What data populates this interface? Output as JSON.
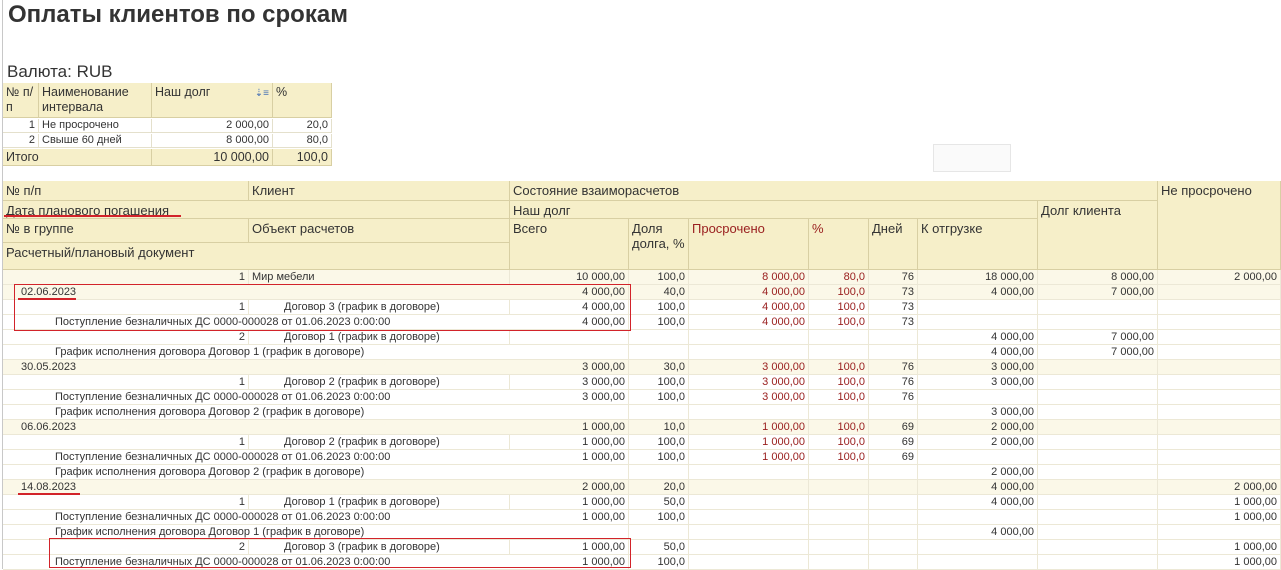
{
  "title": "Оплаты клиентов по срокам",
  "currency": "Валюта: RUB",
  "summary": {
    "headers": [
      "№ п/п",
      "Наименование интервала",
      "Наш долг",
      "%"
    ],
    "rows": [
      [
        "1",
        "Не просрочено",
        "2 000,00",
        "20,0"
      ],
      [
        "2",
        "Свыше 60 дней",
        "8 000,00",
        "80,0"
      ]
    ],
    "total": [
      "Итого",
      "10 000,00",
      "100,0"
    ]
  },
  "main": {
    "headers": {
      "npp": "№ п/п",
      "client": "Клиент",
      "state": "Состояние взаиморасчетов",
      "not_overdue": "Не просрочено",
      "date": "Дата планового погашения",
      "our_debt": "Наш долг",
      "client_debt": "Долг клиента",
      "in_group": "№ в группе",
      "object": "Объект расчетов",
      "total": "Всего",
      "share": "Доля долга, %",
      "overdue": "Просрочено",
      "percent": "%",
      "days": "Дней",
      "to_ship": "К отгрузке",
      "document": "Расчетный/плановый документ"
    },
    "rows": [
      {
        "type": "client",
        "a": "1",
        "b": "Мир мебели",
        "total": "10 000,00",
        "share": "100,0",
        "overdue": "8 000,00",
        "pct": "80,0",
        "days": "76",
        "ship": "18 000,00",
        "cdebt": "8 000,00",
        "notover": "2 000,00"
      },
      {
        "type": "date",
        "a": "02.06.2023",
        "total": "4 000,00",
        "share": "40,0",
        "overdue": "4 000,00",
        "pct": "100,0",
        "days": "73",
        "ship": "4 000,00",
        "cdebt": "7 000,00",
        "notover": ""
      },
      {
        "type": "obj",
        "a": "1",
        "b": "Договор 3 (график в договоре)",
        "total": "4 000,00",
        "share": "100,0",
        "overdue": "4 000,00",
        "pct": "100,0",
        "days": "73",
        "ship": "",
        "cdebt": "",
        "notover": ""
      },
      {
        "type": "doc",
        "a": "Поступление безналичных ДС 0000-000028 от 01.06.2023 0:00:00",
        "total": "4 000,00",
        "share": "100,0",
        "overdue": "4 000,00",
        "pct": "100,0",
        "days": "73",
        "ship": "",
        "cdebt": "",
        "notover": ""
      },
      {
        "type": "obj",
        "a": "2",
        "b": "Договор 1 (график в договоре)",
        "total": "",
        "share": "",
        "overdue": "",
        "pct": "",
        "days": "",
        "ship": "4 000,00",
        "cdebt": "7 000,00",
        "notover": ""
      },
      {
        "type": "doc",
        "a": "График исполнения договора Договор 1 (график в договоре)",
        "total": "",
        "share": "",
        "overdue": "",
        "pct": "",
        "days": "",
        "ship": "4 000,00",
        "cdebt": "7 000,00",
        "notover": ""
      },
      {
        "type": "date",
        "a": "30.05.2023",
        "total": "3 000,00",
        "share": "30,0",
        "overdue": "3 000,00",
        "pct": "100,0",
        "days": "76",
        "ship": "3 000,00",
        "cdebt": "",
        "notover": ""
      },
      {
        "type": "obj",
        "a": "1",
        "b": "Договор 2 (график в договоре)",
        "total": "3 000,00",
        "share": "100,0",
        "overdue": "3 000,00",
        "pct": "100,0",
        "days": "76",
        "ship": "3 000,00",
        "cdebt": "",
        "notover": ""
      },
      {
        "type": "doc",
        "a": "Поступление безналичных ДС 0000-000028 от 01.06.2023 0:00:00",
        "total": "3 000,00",
        "share": "100,0",
        "overdue": "3 000,00",
        "pct": "100,0",
        "days": "76",
        "ship": "",
        "cdebt": "",
        "notover": ""
      },
      {
        "type": "doc",
        "a": "График исполнения договора Договор 2 (график в договоре)",
        "total": "",
        "share": "",
        "overdue": "",
        "pct": "",
        "days": "",
        "ship": "3 000,00",
        "cdebt": "",
        "notover": ""
      },
      {
        "type": "date",
        "a": "06.06.2023",
        "total": "1 000,00",
        "share": "10,0",
        "overdue": "1 000,00",
        "pct": "100,0",
        "days": "69",
        "ship": "2 000,00",
        "cdebt": "",
        "notover": ""
      },
      {
        "type": "obj",
        "a": "1",
        "b": "Договор 2 (график в договоре)",
        "total": "1 000,00",
        "share": "100,0",
        "overdue": "1 000,00",
        "pct": "100,0",
        "days": "69",
        "ship": "2 000,00",
        "cdebt": "",
        "notover": ""
      },
      {
        "type": "doc",
        "a": "Поступление безналичных ДС 0000-000028 от 01.06.2023 0:00:00",
        "total": "1 000,00",
        "share": "100,0",
        "overdue": "1 000,00",
        "pct": "100,0",
        "days": "69",
        "ship": "",
        "cdebt": "",
        "notover": ""
      },
      {
        "type": "doc",
        "a": "График исполнения договора Договор 2 (график в договоре)",
        "total": "",
        "share": "",
        "overdue": "",
        "pct": "",
        "days": "",
        "ship": "2 000,00",
        "cdebt": "",
        "notover": ""
      },
      {
        "type": "date",
        "a": "14.08.2023",
        "total": "2 000,00",
        "share": "20,0",
        "overdue": "",
        "pct": "",
        "days": "",
        "ship": "4 000,00",
        "cdebt": "",
        "notover": "2 000,00"
      },
      {
        "type": "obj",
        "a": "1",
        "b": "Договор 1 (график в договоре)",
        "total": "1 000,00",
        "share": "50,0",
        "overdue": "",
        "pct": "",
        "days": "",
        "ship": "4 000,00",
        "cdebt": "",
        "notover": "1 000,00"
      },
      {
        "type": "doc",
        "a": "Поступление безналичных ДС 0000-000028 от 01.06.2023 0:00:00",
        "total": "1 000,00",
        "share": "100,0",
        "overdue": "",
        "pct": "",
        "days": "",
        "ship": "",
        "cdebt": "",
        "notover": "1 000,00"
      },
      {
        "type": "doc",
        "a": "График исполнения договора Договор 1 (график в договоре)",
        "total": "",
        "share": "",
        "overdue": "",
        "pct": "",
        "days": "",
        "ship": "4 000,00",
        "cdebt": "",
        "notover": ""
      },
      {
        "type": "obj",
        "a": "2",
        "b": "Договор 3 (график в договоре)",
        "total": "1 000,00",
        "share": "50,0",
        "overdue": "",
        "pct": "",
        "days": "",
        "ship": "",
        "cdebt": "",
        "notover": "1 000,00"
      },
      {
        "type": "doc",
        "a": "Поступление безналичных ДС 0000-000028 от 01.06.2023 0:00:00",
        "total": "1 000,00",
        "share": "100,0",
        "overdue": "",
        "pct": "",
        "days": "",
        "ship": "",
        "cdebt": "",
        "notover": "1 000,00"
      }
    ]
  },
  "colors": {
    "header_bg": "#f6efc9",
    "overdue_text": "#9a2020",
    "highlight_annotation": "#d2232a"
  },
  "icons": {
    "sort": "sort-descending-icon"
  }
}
